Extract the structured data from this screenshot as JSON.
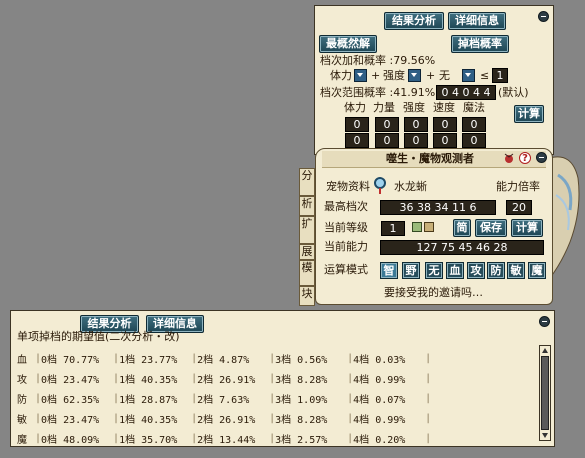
{
  "top_panel": {
    "btn_result": "结果分析",
    "btn_detail": "详细信息",
    "btn_best": "最概然解",
    "btn_drop_rate": "掉档概率",
    "sum_prob": "档次加和概率 :79.56%",
    "stat1": "体力",
    "plus1": "+",
    "stat2": "强度",
    "plus2": "+",
    "stat3": "无",
    "le": "≤",
    "le_val": "1",
    "range_prob": "档次范围概率 :41.91%",
    "range_code": "0 4 0 4 4",
    "default_note": "(默认)",
    "cols": [
      "体力",
      "力量",
      "强度",
      "速度",
      "魔法"
    ],
    "row1": [
      "0",
      "0",
      "0",
      "0",
      "0"
    ],
    "row2": [
      "0",
      "0",
      "0",
      "0",
      "0"
    ],
    "btn_calc": "计算"
  },
  "observer": {
    "title": "噬生・魔物观测者",
    "side_tabs": [
      "分",
      "析",
      "扩",
      "展",
      "模",
      "块"
    ],
    "pet_label": "宠物资料",
    "pet_name": "水龙蜥",
    "multiplier_label": "能力倍率",
    "max_label": "最高档次",
    "max_val": "36 38 34 11 6",
    "max_mult": "20",
    "level_label": "当前等级",
    "level_val": "1",
    "btn_simple": "简",
    "btn_save": "保存",
    "btn_calc": "计算",
    "ability_label": "当前能力",
    "ability_val": "127 75 45 46 28",
    "mode_label": "运算模式",
    "modes": [
      "智",
      "野",
      "无",
      "血",
      "攻",
      "防",
      "敏",
      "魔"
    ],
    "invite": "要接受我的邀请吗…"
  },
  "bottom_panel": {
    "btn_result": "结果分析",
    "btn_detail": "详细信息",
    "header": "单项掉档的期望值(二次分析・改)",
    "rows": [
      {
        "stat": "血",
        "cells": [
          "0档 70.77%",
          "1档 23.77%",
          "2档  4.87%",
          "3档  0.56%",
          "4档  0.03%"
        ]
      },
      {
        "stat": "攻",
        "cells": [
          "0档 23.47%",
          "1档 40.35%",
          "2档 26.91%",
          "3档  8.28%",
          "4档  0.99%"
        ]
      },
      {
        "stat": "防",
        "cells": [
          "0档 62.35%",
          "1档 28.87%",
          "2档  7.63%",
          "3档  1.09%",
          "4档  0.07%"
        ]
      },
      {
        "stat": "敏",
        "cells": [
          "0档 23.47%",
          "1档 40.35%",
          "2档 26.91%",
          "3档  8.28%",
          "4档  0.99%"
        ]
      },
      {
        "stat": "魔",
        "cells": [
          "0档 48.09%",
          "1档 35.70%",
          "2档 13.44%",
          "3档  2.57%",
          "4档  0.20%"
        ]
      }
    ]
  }
}
